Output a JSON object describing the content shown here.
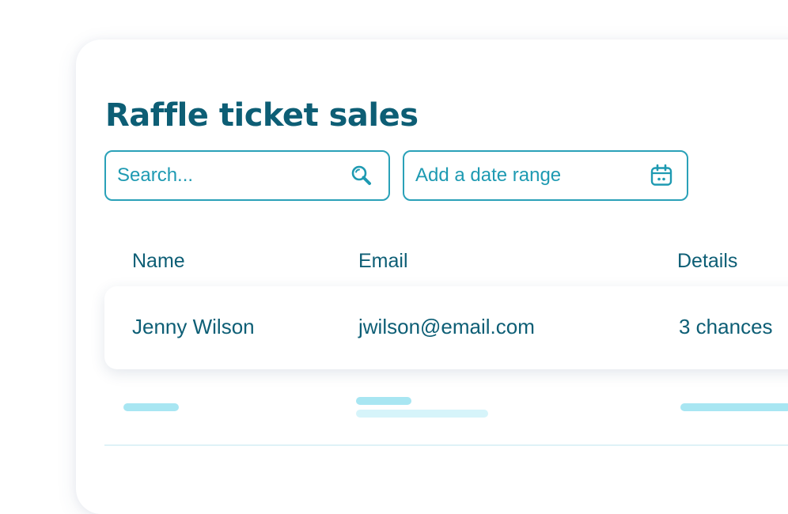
{
  "page": {
    "title": "Raffle ticket sales"
  },
  "filters": {
    "search_placeholder": "Search...",
    "search_icon": "search-icon",
    "date_range_placeholder": "Add a date range",
    "date_icon": "calendar-icon"
  },
  "table": {
    "columns": [
      "Name",
      "Email",
      "Details"
    ],
    "rows": [
      {
        "name": "Jenny Wilson",
        "email": "jwilson@email.com",
        "details": "3 chances"
      }
    ]
  },
  "colors": {
    "accent": "#2aa1b8",
    "text": "#0d5e75",
    "skeleton_primary": "#a8e6f2",
    "skeleton_secondary": "#d6f4fa"
  }
}
